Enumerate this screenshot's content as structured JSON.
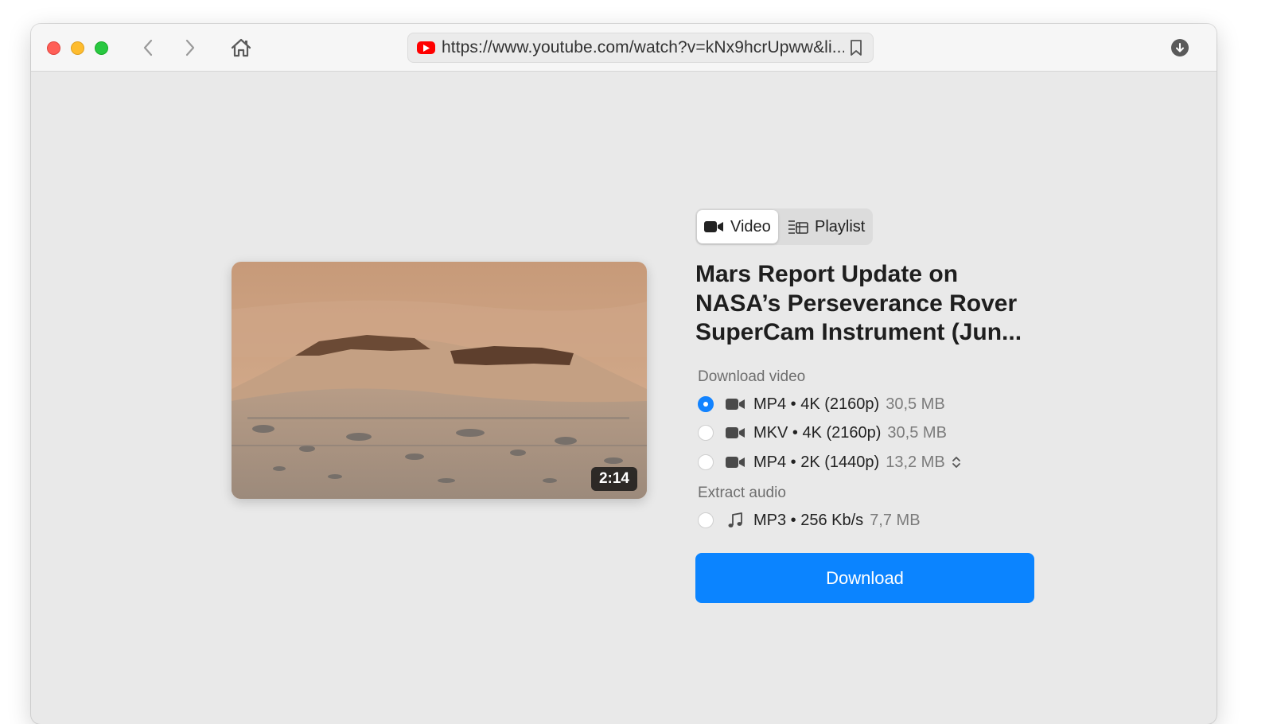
{
  "browser": {
    "url": "https://www.youtube.com/watch?v=kNx9hcrUpww&li...",
    "icons": {
      "back": "chevron-left-icon",
      "forward": "chevron-right-icon",
      "home": "home-icon",
      "site": "youtube-icon",
      "bookmark": "bookmark-icon",
      "downloads": "download-circle-icon"
    }
  },
  "tabs": [
    {
      "label": "Video",
      "icon": "video-camera-icon",
      "active": true
    },
    {
      "label": "Playlist",
      "icon": "playlist-icon",
      "active": false
    }
  ],
  "video": {
    "title": "Mars Report  Update on NASA’s Perseverance Rover SuperCam Instrument (Jun...",
    "duration": "2:14"
  },
  "download_video": {
    "label": "Download video",
    "options": [
      {
        "label": "MP4 • 4K (2160p)",
        "size": "30,5 MB",
        "selected": true
      },
      {
        "label": "MKV • 4K (2160p)",
        "size": "30,5 MB",
        "selected": false
      },
      {
        "label": "MP4 • 2K (1440p)",
        "size": "13,2 MB",
        "selected": false
      }
    ]
  },
  "extract_audio": {
    "label": "Extract audio",
    "options": [
      {
        "label": "MP3 • 256 Kb/s",
        "size": "7,7 MB",
        "selected": false
      }
    ]
  },
  "download_button": {
    "label": "Download"
  },
  "colors": {
    "accent": "#0b84ff",
    "window_bg": "#e9e9e9",
    "toolbar_bg": "#f6f6f6",
    "youtube_red": "#ff0000"
  }
}
